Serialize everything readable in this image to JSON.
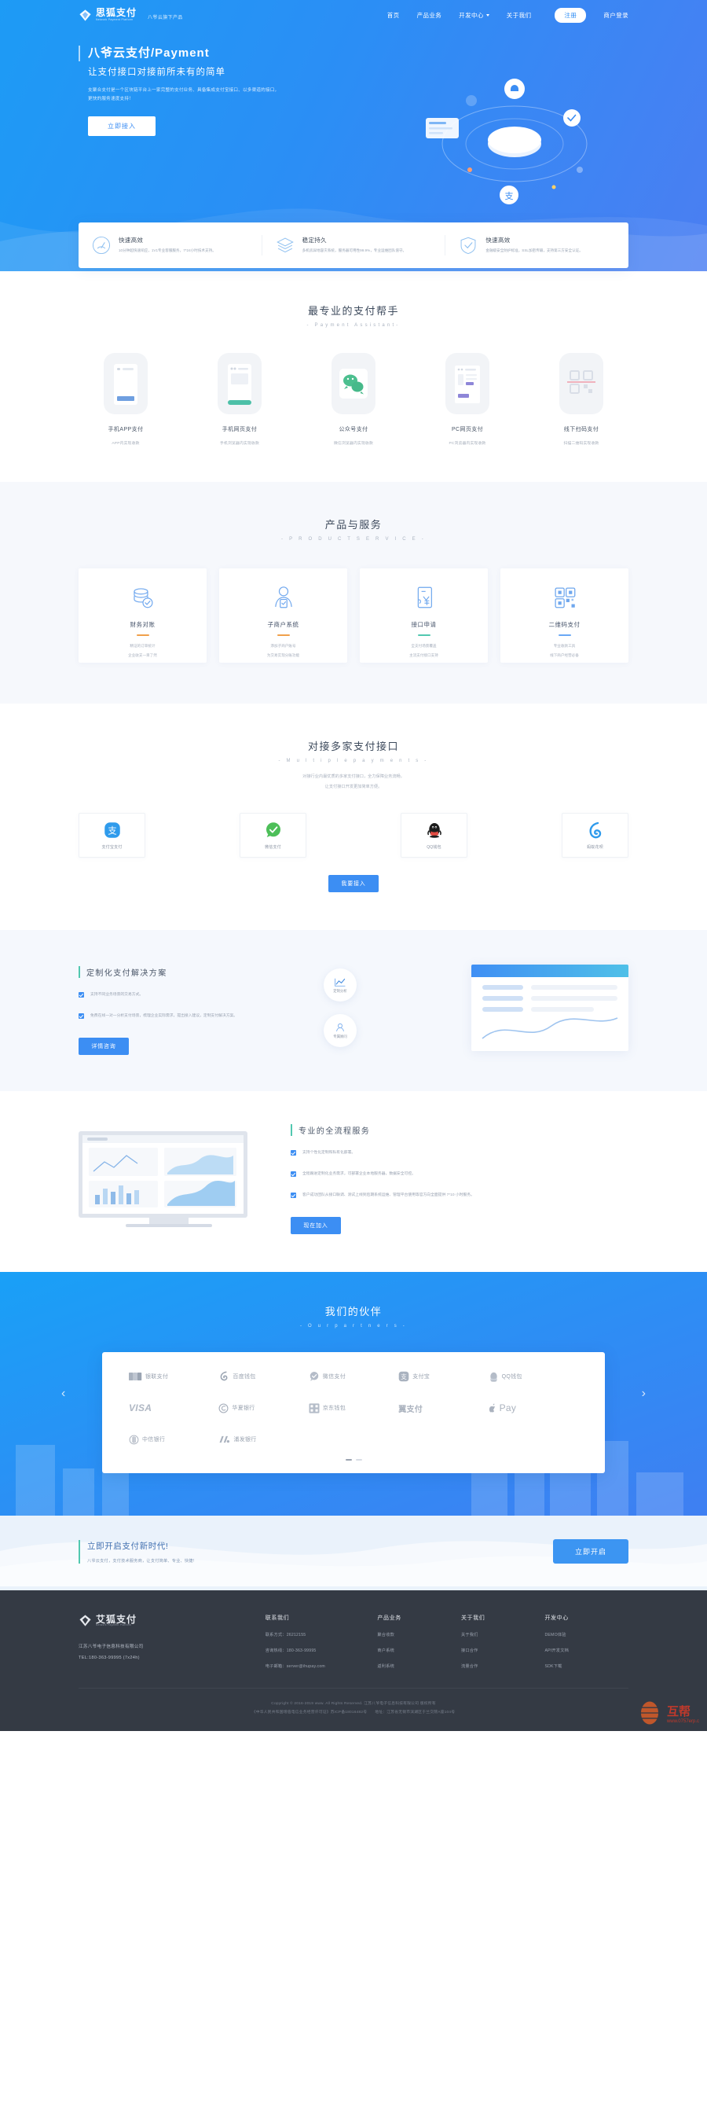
{
  "header": {
    "logo_cn": "思狐支付",
    "logo_en": "Network Payment Platform",
    "tagline": "八爷云旗下产品",
    "nav": [
      {
        "label": "首页",
        "has_caret": false
      },
      {
        "label": "产品业务",
        "has_caret": false
      },
      {
        "label": "开发中心",
        "has_caret": true
      },
      {
        "label": "关于我们",
        "has_caret": false
      }
    ],
    "register_label": "注册",
    "login_label": "商户登录"
  },
  "hero": {
    "title": "八爷云支付/Payment",
    "subtitle": "让支付接口对接前所未有的简单",
    "description": "支聚合支付是一个区块链平台上一家完整的支付业务、具备集成支付宝接口、以多渠道的接口，更快的服务速度支持！",
    "cta": "立即接入"
  },
  "features": [
    {
      "icon": "speedometer-icon",
      "title": "快速高效",
      "desc": "10分钟超快速响应，1V1专业客服服务，7*24小时技术支持。"
    },
    {
      "icon": "layers-icon",
      "title": "稳定持久",
      "desc": "多机房异地容灾系统，服务器可用性99.9%，专业运维团队值守。"
    },
    {
      "icon": "shield-check-icon",
      "title": "快速高效",
      "desc": "金融级安全防护标准，SSL加密传输，支持第三方安全认证。"
    }
  ],
  "assistant": {
    "title": "最专业的支付帮手",
    "subtitle": "- Payment Assistant-",
    "cards": [
      {
        "icon": "mobile-app-icon",
        "label": "手机APP支付",
        "desc": "APP内实现收款"
      },
      {
        "icon": "mobile-web-icon",
        "label": "手机网页支付",
        "desc": "手机浏览器内实现收款"
      },
      {
        "icon": "wechat-official-icon",
        "label": "公众号支付",
        "desc": "微信浏览器内实现收款"
      },
      {
        "icon": "pc-web-icon",
        "label": "PC网页支付",
        "desc": "PC浏览器内实现收款"
      },
      {
        "icon": "qrcode-scan-icon",
        "label": "线下扫码支付",
        "desc": "扫描二维码实现收款"
      }
    ]
  },
  "product": {
    "title": "产品与服务",
    "subtitle": "- P R O D U C T   S E R V I C E -",
    "cards": [
      {
        "icon": "coins-check-icon",
        "title": "财务对账",
        "accent": "#f0a04b",
        "d1": "精证的订单统计",
        "d2": "企业收支一目了然"
      },
      {
        "icon": "merchant-user-icon",
        "title": "子商户系统",
        "accent": "#f0a04b",
        "d1": "添加子商户账号",
        "d2": "为交易实现分账功能"
      },
      {
        "icon": "contract-icon",
        "title": "接口申请",
        "accent": "#52c8b0",
        "d1": "全支付场景覆盖",
        "d2": "主流支付接口支持"
      },
      {
        "icon": "qrcode-icon",
        "title": "二维码支付",
        "accent": "#6aa8f5",
        "d1": "专业收款工具",
        "d2": "线下商户经营必备"
      }
    ]
  },
  "multiple": {
    "title": "对接多家支付接口",
    "subtitle": "- M u l t i p l e   p a y m e n t s -",
    "note1": "对接行业内最优质的多家支付接口，全力保障业务流畅，",
    "note2": "让支付接口开发更加简单方便。",
    "cards": [
      {
        "icon": "alipay-icon",
        "label": "支付宝支付"
      },
      {
        "icon": "wechatpay-icon",
        "label": "微信支付"
      },
      {
        "icon": "qqwallet-icon",
        "label": "QQ钱包"
      },
      {
        "icon": "huabei-icon",
        "label": "蚂蚁花呗"
      }
    ],
    "cta": "我要接入"
  },
  "solution": {
    "title": "定制化支付解决方案",
    "items": [
      "支持不同业务场景的交易方式。",
      "免费在线一对一分析支付场景，梳理企业实际需求，提出接入建议，定制支付解决方案。"
    ],
    "cta": "详情咨询",
    "bubbles": [
      {
        "icon": "chart-line-icon",
        "label": "定制分析"
      },
      {
        "icon": "user-support-icon",
        "label": "专属顾问"
      }
    ]
  },
  "process": {
    "title": "专业的全流程服务",
    "items": [
      "支持个性化定制和私有化部署。",
      "全程跟进定制化业务需求，可部署企业本地服务器，数据安全可控。",
      "客户成功团队从接口联调、测试上线到后期系统运维、管理平台使用等官方向全面提供 7*10 小时服务。"
    ],
    "cta": "现在加入"
  },
  "partners": {
    "title": "我们的伙伴",
    "subtitle": "- O u r   p a r t n e r s -",
    "logos": [
      {
        "icon": "unionpay-icon",
        "label": "银联支付"
      },
      {
        "icon": "baidu-wallet-icon",
        "label": "百度钱包"
      },
      {
        "icon": "wechatpay-icon",
        "label": "微信支付"
      },
      {
        "icon": "alipay-icon",
        "label": "支付宝"
      },
      {
        "icon": "qqwallet-icon",
        "label": "QQ钱包"
      },
      {
        "icon": "visa-icon",
        "label": "VISA"
      },
      {
        "icon": "huaxia-bank-icon",
        "label": "华夏银行"
      },
      {
        "icon": "jd-wallet-icon",
        "label": "京东钱包"
      },
      {
        "icon": "yizhifu-icon",
        "label": "翼支付"
      },
      {
        "icon": "apple-pay-icon",
        "label": "Pay"
      },
      {
        "icon": "citic-bank-icon",
        "label": "中信银行"
      },
      {
        "icon": "spdb-bank-icon",
        "label": "浦发银行"
      }
    ],
    "prev_icon": "chevron-left-icon",
    "next_icon": "chevron-right-icon"
  },
  "cta_band": {
    "title": "立即开启支付新时代!",
    "desc": "八爷云支付，支付技术服务商，让支付简单、专业、快捷!",
    "button": "立即开启"
  },
  "footer": {
    "logo_cn": "艾狐支付",
    "logo_en": "Network Payment Platform",
    "company": "江苏八爷电子信息科技有限公司",
    "tel": "TEL:180-363-99995 (7x24h)",
    "columns": [
      {
        "heading": "联系我们",
        "items": [
          "联系方式：26212155",
          "咨询热线：180-363-99995",
          "电子邮箱：server@ihupay.com"
        ]
      },
      {
        "heading": "产品业务",
        "items": [
          "聚合收款",
          "商户系统",
          "返利系统"
        ]
      },
      {
        "heading": "关于我们",
        "items": [
          "关于我们",
          "接口合作",
          "流量合作"
        ]
      },
      {
        "heading": "开发中心",
        "items": [
          "DEMO体验",
          "API开发文档",
          "SDK下载"
        ]
      }
    ],
    "copyright": "Copyright © 2016-2019 www. All Rights Reserved. 江苏八爷电子信息科技有限公司 版权所有",
    "icp": "《中华人民共和国增值电信业务经营许可证》苏ICP备18016482号　　地址：江苏省无锡市滨湖区于兰交院A座104号",
    "watermark_text": "互帮",
    "watermark_url": "www.0757erp.c"
  },
  "colors": {
    "brand_blue": "#3c8ef3",
    "hero_blue": "#2b8ef5",
    "teal": "#52c8b0",
    "footer_bg": "#343a44"
  }
}
